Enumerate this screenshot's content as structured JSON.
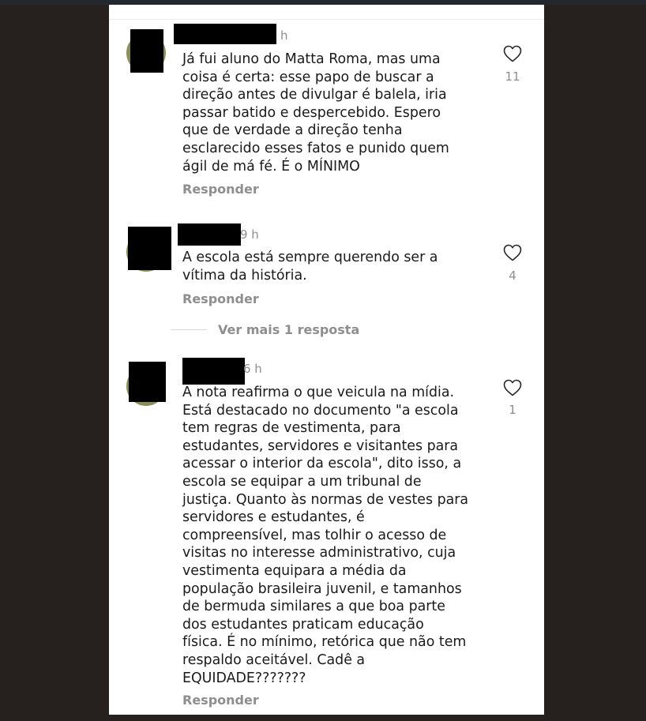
{
  "comments": [
    {
      "time": "h",
      "lines": [
        "Já fui aluno do Matta Roma, mas uma",
        "coisa é certa: esse papo de buscar a",
        "direção antes de divulgar é balela, iria",
        "passar batido e despercebido. Espero",
        "que de verdade a direção tenha",
        "esclarecido esses fatos e punido quem",
        "ágil de má fé. É o MÍNIMO"
      ],
      "reply_label": "Responder",
      "likes": "11"
    },
    {
      "time": "9 h",
      "lines": [
        "A escola está sempre querendo ser a",
        "vítima da história."
      ],
      "reply_label": "Responder",
      "likes": "4",
      "more_replies": "Ver mais 1 resposta"
    },
    {
      "time": "6 h",
      "lines": [
        "A nota reafirma o que veicula na mídia.",
        "Está destacado no documento \"a escola",
        "tem regras de vestimenta, para",
        "estudantes, servidores e visitantes para",
        "acessar o interior da escola\", dito isso, a",
        "escola se equipar a um tribunal de",
        "justiça. Quanto às normas de vestes para",
        "servidores e estudantes, é",
        "compreensível, mas tolhir o acesso de",
        "visitas no interesse administrativo, cuja",
        "vestimenta equipara a média da",
        "população brasileira juvenil, e tamanhos",
        "de bermuda similares a que boa parte",
        "dos estudantes praticam educação",
        "física. É no mínimo, retórica que não tem",
        "respaldo aceitável. Cadê a",
        "EQUIDADE???????"
      ],
      "reply_label": "Responder",
      "likes": "1"
    }
  ],
  "icons": {
    "like": "heart-outline-icon"
  },
  "colors": {
    "background": "#26211f",
    "panel": "#ffffff",
    "text": "#1a1a1a",
    "muted": "#8e8e8e",
    "redaction": "#000000"
  }
}
